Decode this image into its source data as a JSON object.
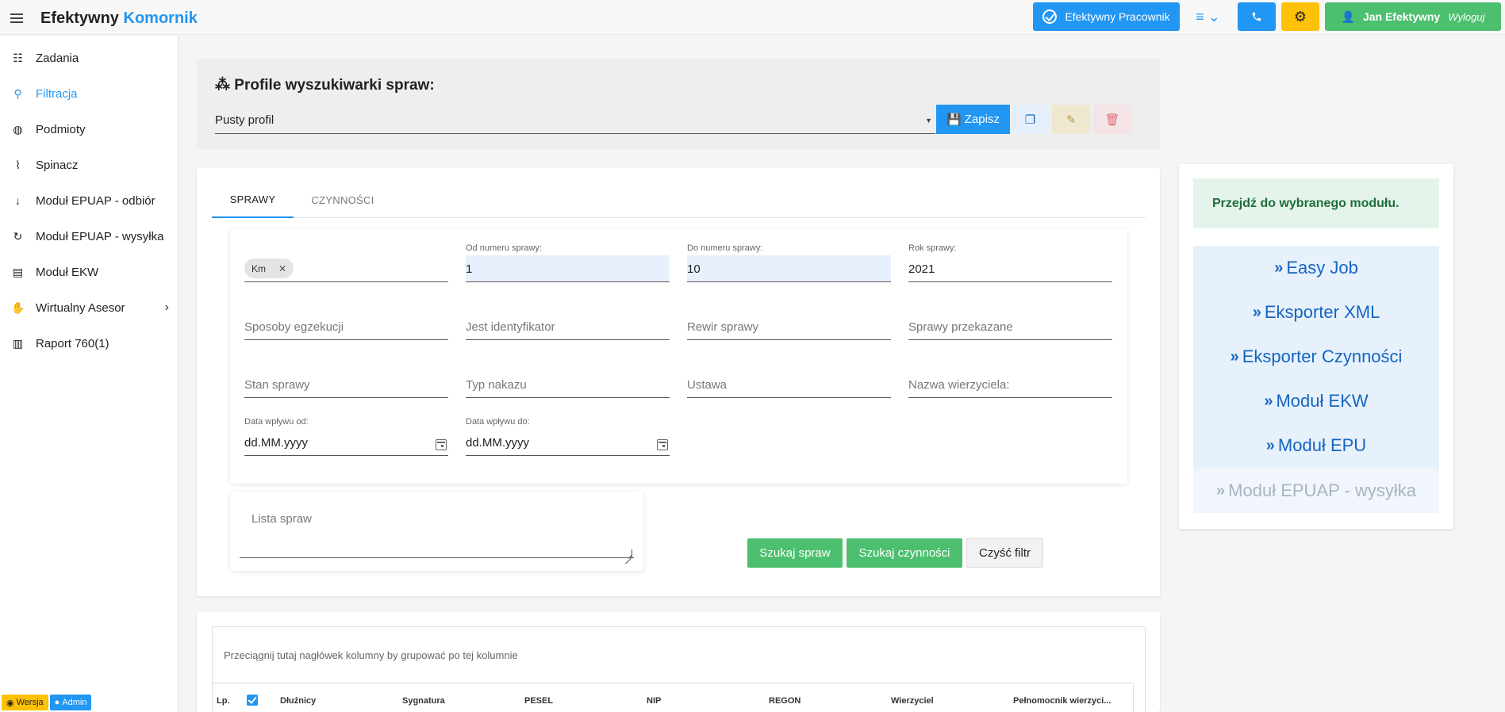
{
  "header": {
    "brand_main": "Efektywny",
    "brand_accent": "Komornik",
    "pracownik_label": "Efektywny Pracownik",
    "menu_icon": "≡ ⌄",
    "user_name": "Jan Efektywny",
    "logout_label": "Wyloguj"
  },
  "sidebar": {
    "items": [
      {
        "label": "Zadania",
        "icon": "tasks-icon",
        "glyph": "☷",
        "active": false
      },
      {
        "label": "Filtracja",
        "icon": "search-icon",
        "glyph": "⚲",
        "active": true
      },
      {
        "label": "Podmioty",
        "icon": "globe-icon",
        "glyph": "◍",
        "active": false
      },
      {
        "label": "Spinacz",
        "icon": "paperclip-icon",
        "glyph": "⌇",
        "active": false
      },
      {
        "label": "Moduł EPUAP - odbiór",
        "icon": "arrow-down-icon",
        "glyph": "↓",
        "active": false
      },
      {
        "label": "Moduł EPUAP - wysyłka",
        "icon": "redo-icon",
        "glyph": "↻",
        "active": false
      },
      {
        "label": "Moduł EKW",
        "icon": "book-icon",
        "glyph": "▤",
        "active": false
      },
      {
        "label": "Wirtualny Asesor",
        "icon": "handshake-icon",
        "glyph": "✋",
        "active": false
      },
      {
        "label": "Raport 760(1)",
        "icon": "file-icon",
        "glyph": "▥",
        "active": false
      }
    ],
    "badge_version": "Wersja",
    "badge_admin": "Admin"
  },
  "profile": {
    "title": "Profile wyszukiwarki spraw:",
    "selected": "Pusty profil",
    "save_label": "Zapisz"
  },
  "tabs": [
    "SPRAWY",
    "CZYNNOŚCI"
  ],
  "filters": {
    "chip": "Km",
    "od_label": "Od numeru sprawy:",
    "od_value": "1",
    "do_label": "Do numeru sprawy:",
    "do_value": "10",
    "rok_label": "Rok sprawy:",
    "rok_value": "2021",
    "sposoby": "Sposoby egzekucji",
    "identyfikator": "Jest identyfikator",
    "rewir": "Rewir sprawy",
    "przekazane": "Sprawy przekazane",
    "stan": "Stan sprawy",
    "typ": "Typ nakazu",
    "ustawa": "Ustawa",
    "wierzyciel": "Nazwa wierzyciela:",
    "data_od_label": "Data wpływu od:",
    "data_od_value": "dd.MM.yyyy",
    "data_do_label": "Data wpływu do:",
    "data_do_value": "dd.MM.yyyy",
    "lista_placeholder": "Lista spraw"
  },
  "actions": {
    "search_cases": "Szukaj spraw",
    "search_activities": "Szukaj czynności",
    "clear": "Czyść filtr"
  },
  "grid": {
    "group_hint": "Przeciągnij tutaj nagłówek kolumny by grupować po tej kolumnie",
    "columns": [
      "Lp.",
      "Dłużnicy",
      "Sygnatura",
      "PESEL",
      "NIP",
      "REGON",
      "Wierzyciel",
      "Pełnomocnik wierzyci..."
    ]
  },
  "modules": {
    "message": "Przejdź do wybranego modułu.",
    "items": [
      {
        "label": "Easy Job",
        "enabled": true
      },
      {
        "label": "Eksporter XML",
        "enabled": true
      },
      {
        "label": "Eksporter Czynności",
        "enabled": true
      },
      {
        "label": "Moduł EKW",
        "enabled": true
      },
      {
        "label": "Moduł EPU",
        "enabled": true
      },
      {
        "label": "Moduł EPUAP - wysyłka",
        "enabled": false
      }
    ]
  },
  "colors": {
    "primary": "#2196f3",
    "success": "#4cc06f",
    "warning": "#ffc107"
  }
}
